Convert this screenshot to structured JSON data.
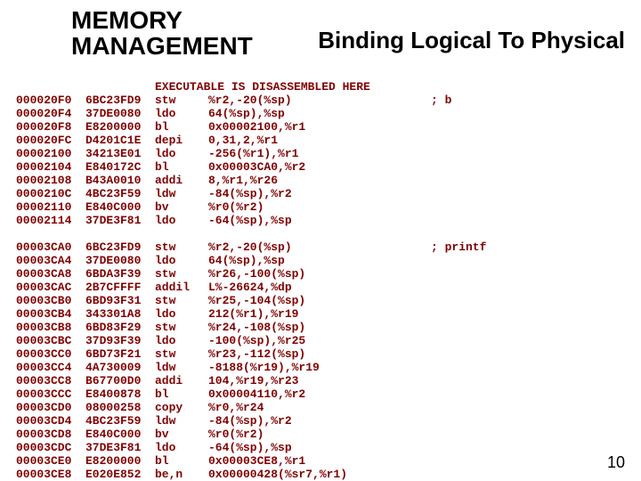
{
  "header": {
    "left_line1": "MEMORY",
    "left_line2": "MANAGEMENT",
    "right": "Binding Logical To Physical"
  },
  "banner": "EXECUTABLE IS DISASSEMBLED HERE",
  "block1": [
    {
      "addr": "000020F0",
      "hex": "6BC23FD9",
      "mn": "stw",
      "ops": "%r2,-20(%sp)",
      "cmt": "; b"
    },
    {
      "addr": "000020F4",
      "hex": "37DE0080",
      "mn": "ldo",
      "ops": "64(%sp),%sp",
      "cmt": ""
    },
    {
      "addr": "000020F8",
      "hex": "E8200000",
      "mn": "bl",
      "ops": "0x00002100,%r1",
      "cmt": ""
    },
    {
      "addr": "000020FC",
      "hex": "D4201C1E",
      "mn": "depi",
      "ops": "0,31,2,%r1",
      "cmt": ""
    },
    {
      "addr": "00002100",
      "hex": "34213E01",
      "mn": "ldo",
      "ops": "-256(%r1),%r1",
      "cmt": ""
    },
    {
      "addr": "00002104",
      "hex": "E840172C",
      "mn": "bl",
      "ops": "0x00003CA0,%r2",
      "cmt": ""
    },
    {
      "addr": "00002108",
      "hex": "B43A0010",
      "mn": "addi",
      "ops": "8,%r1,%r26",
      "cmt": ""
    },
    {
      "addr": "0000210C",
      "hex": "4BC23F59",
      "mn": "ldw",
      "ops": "-84(%sp),%r2",
      "cmt": ""
    },
    {
      "addr": "00002110",
      "hex": "E840C000",
      "mn": "bv",
      "ops": "%r0(%r2)",
      "cmt": ""
    },
    {
      "addr": "00002114",
      "hex": "37DE3F81",
      "mn": "ldo",
      "ops": "-64(%sp),%sp",
      "cmt": ""
    }
  ],
  "block2": [
    {
      "addr": "00003CA0",
      "hex": "6BC23FD9",
      "mn": "stw",
      "ops": "%r2,-20(%sp)",
      "cmt": "; printf"
    },
    {
      "addr": "00003CA4",
      "hex": "37DE0080",
      "mn": "ldo",
      "ops": "64(%sp),%sp",
      "cmt": ""
    },
    {
      "addr": "00003CA8",
      "hex": "6BDA3F39",
      "mn": "stw",
      "ops": "%r26,-100(%sp)",
      "cmt": ""
    },
    {
      "addr": "00003CAC",
      "hex": "2B7CFFFF",
      "mn": "addil",
      "ops": "L%-26624,%dp",
      "cmt": ""
    },
    {
      "addr": "00003CB0",
      "hex": "6BD93F31",
      "mn": "stw",
      "ops": "%r25,-104(%sp)",
      "cmt": ""
    },
    {
      "addr": "00003CB4",
      "hex": "343301A8",
      "mn": "ldo",
      "ops": "212(%r1),%r19",
      "cmt": ""
    },
    {
      "addr": "00003CB8",
      "hex": "6BD83F29",
      "mn": "stw",
      "ops": "%r24,-108(%sp)",
      "cmt": ""
    },
    {
      "addr": "00003CBC",
      "hex": "37D93F39",
      "mn": "ldo",
      "ops": "-100(%sp),%r25",
      "cmt": ""
    },
    {
      "addr": "00003CC0",
      "hex": "6BD73F21",
      "mn": "stw",
      "ops": "%r23,-112(%sp)",
      "cmt": ""
    },
    {
      "addr": "00003CC4",
      "hex": "4A730009",
      "mn": "ldw",
      "ops": "-8188(%r19),%r19",
      "cmt": ""
    },
    {
      "addr": "00003CC8",
      "hex": "B67700D0",
      "mn": "addi",
      "ops": "104,%r19,%r23",
      "cmt": ""
    },
    {
      "addr": "00003CCC",
      "hex": "E8400878",
      "mn": "bl",
      "ops": "0x00004110,%r2",
      "cmt": ""
    },
    {
      "addr": "00003CD0",
      "hex": "08000258",
      "mn": "copy",
      "ops": "%r0,%r24",
      "cmt": ""
    },
    {
      "addr": "00003CD4",
      "hex": "4BC23F59",
      "mn": "ldw",
      "ops": "-84(%sp),%r2",
      "cmt": ""
    },
    {
      "addr": "00003CD8",
      "hex": "E840C000",
      "mn": "bv",
      "ops": "%r0(%r2)",
      "cmt": ""
    },
    {
      "addr": "00003CDC",
      "hex": "37DE3F81",
      "mn": "ldo",
      "ops": "-64(%sp),%sp",
      "cmt": ""
    },
    {
      "addr": "00003CE0",
      "hex": "E8200000",
      "mn": "bl",
      "ops": "0x00003CE8,%r1",
      "cmt": ""
    },
    {
      "addr": "00003CE8",
      "hex": "E020E852",
      "mn": "be,n",
      "ops": "0x00000428(%sr7,%r1)",
      "cmt": ""
    }
  ],
  "page_number": "10"
}
